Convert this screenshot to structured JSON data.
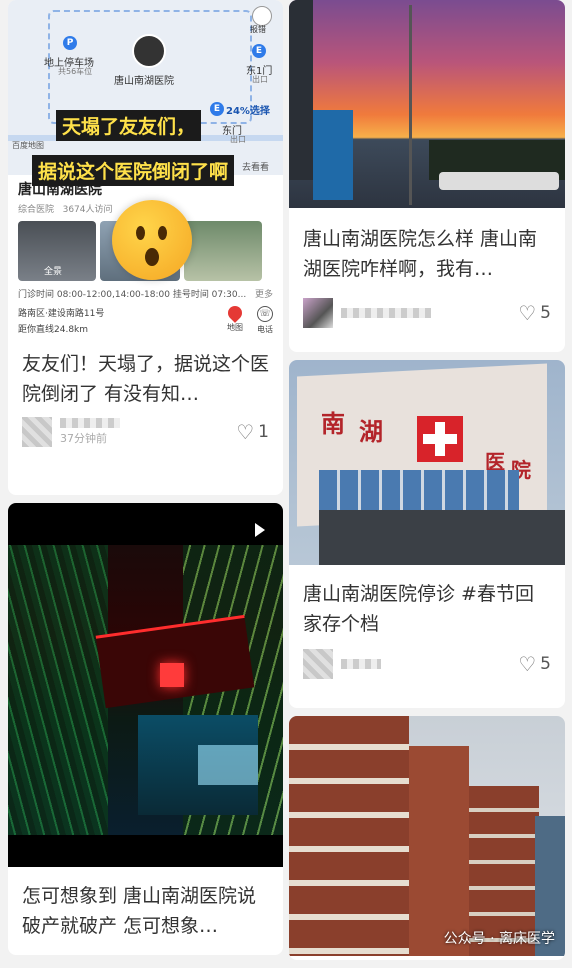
{
  "left_column": {
    "card1": {
      "map": {
        "overlay_text_1": "天塌了友友们，",
        "overlay_text_2": "据说这个医院倒闭了啊",
        "poi_name": "唐山南湖医院",
        "pin_label": "唐山南湖医院",
        "parking_label": "地上停车场",
        "parking_sub": "共56车位",
        "gate1": "东1门",
        "gate1_sub": "出口",
        "gate2": "东门",
        "gate2_sub": "出口",
        "report": "报错",
        "percent": "24%选择",
        "more": "去看看",
        "map_source": "百度地图"
      },
      "poi": {
        "title": "唐山南湖医院",
        "category": "综合医院",
        "visits": "3674人访问",
        "panorama": "全景",
        "hours": "门诊时间 08:00-12:00,14:00-18:00 挂号时间 07:30...",
        "more": "更多",
        "address": "路南区·建设南路11号",
        "distance": "距你直线24.8km",
        "map_btn": "地图",
        "phone_btn": "电话"
      },
      "text": "友友们！天塌了，据说这个医院倒闭了 有没有知…",
      "likes": "1",
      "time": "37分钟前"
    },
    "card2": {
      "text": "怎可想象到 唐山南湖医院说破产就破产 怎可想象…"
    }
  },
  "right_column": {
    "card1": {
      "text": "唐山南湖医院怎么样 唐山南湖医院咋样啊，我有…",
      "likes": "5"
    },
    "card2": {
      "sign_1": "南",
      "sign_2": "湖",
      "sign_3": "医",
      "sign_4": "院",
      "text": "唐山南湖医院停诊 #春节回家存个档",
      "likes": "5"
    },
    "card3": {
      "watermark": "公众号 · 离床医学"
    }
  },
  "colors": {
    "caption_yellow": "#ffe14a",
    "cross_red": "#d8232a",
    "map_blue": "#2f7be9"
  }
}
